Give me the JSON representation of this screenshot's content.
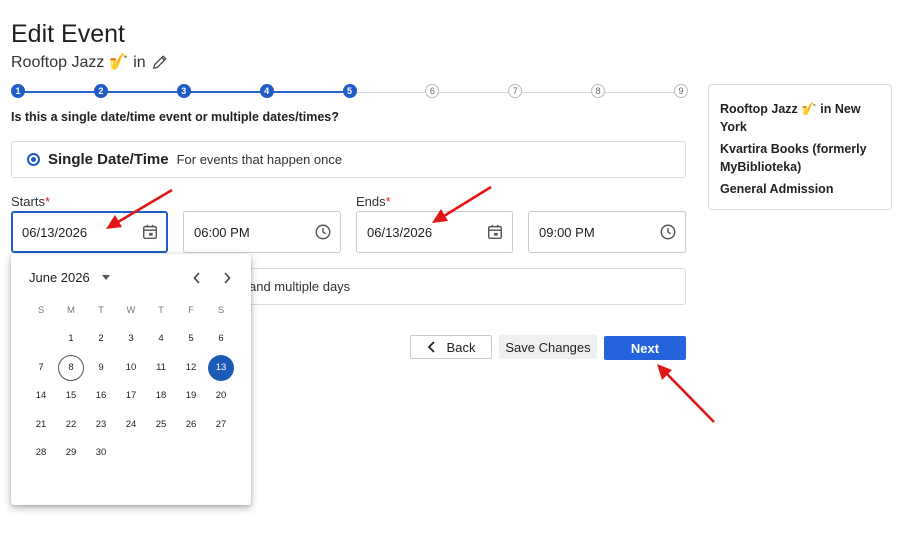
{
  "header": {
    "title": "Edit Event",
    "event_name": "Rooftop Jazz 🎷 in"
  },
  "stepper": {
    "steps": [
      "1",
      "2",
      "3",
      "4",
      "5",
      "6",
      "7",
      "8",
      "9"
    ],
    "current_step": 5
  },
  "question": "Is this a single date/time event or multiple dates/times?",
  "single_option": {
    "label": "Single Date/Time",
    "description": "For events that happen once"
  },
  "multi_option": {
    "description_partial": "and multiple days"
  },
  "starts": {
    "label": "Starts",
    "required_mark": "*",
    "date": "06/13/2026",
    "time": "06:00 PM"
  },
  "ends": {
    "label": "Ends",
    "required_mark": "*",
    "date": "06/13/2026",
    "time": "09:00 PM"
  },
  "calendar": {
    "month_label": "June 2026",
    "weekdays": [
      "S",
      "M",
      "T",
      "W",
      "T",
      "F",
      "S"
    ],
    "days": [
      "1",
      "2",
      "3",
      "4",
      "5",
      "6",
      "7",
      "8",
      "9",
      "10",
      "11",
      "12",
      "13",
      "14",
      "15",
      "16",
      "17",
      "18",
      "19",
      "20",
      "21",
      "22",
      "23",
      "24",
      "25",
      "26",
      "27",
      "28",
      "29",
      "30"
    ],
    "first_weekday_index": 1,
    "today": "8",
    "selected": "13"
  },
  "buttons": {
    "back": "Back",
    "save": "Save Changes",
    "next": "Next"
  },
  "summary": {
    "event": "Rooftop Jazz 🎷 in New York",
    "venue": "Kvartira Books (formerly MyBiblioteka)",
    "ticket": "General Admission"
  },
  "colors": {
    "accent": "#1f5cc8",
    "primary_button": "#2563dc",
    "annotation_arrow": "#e01515",
    "required": "#d62828"
  }
}
